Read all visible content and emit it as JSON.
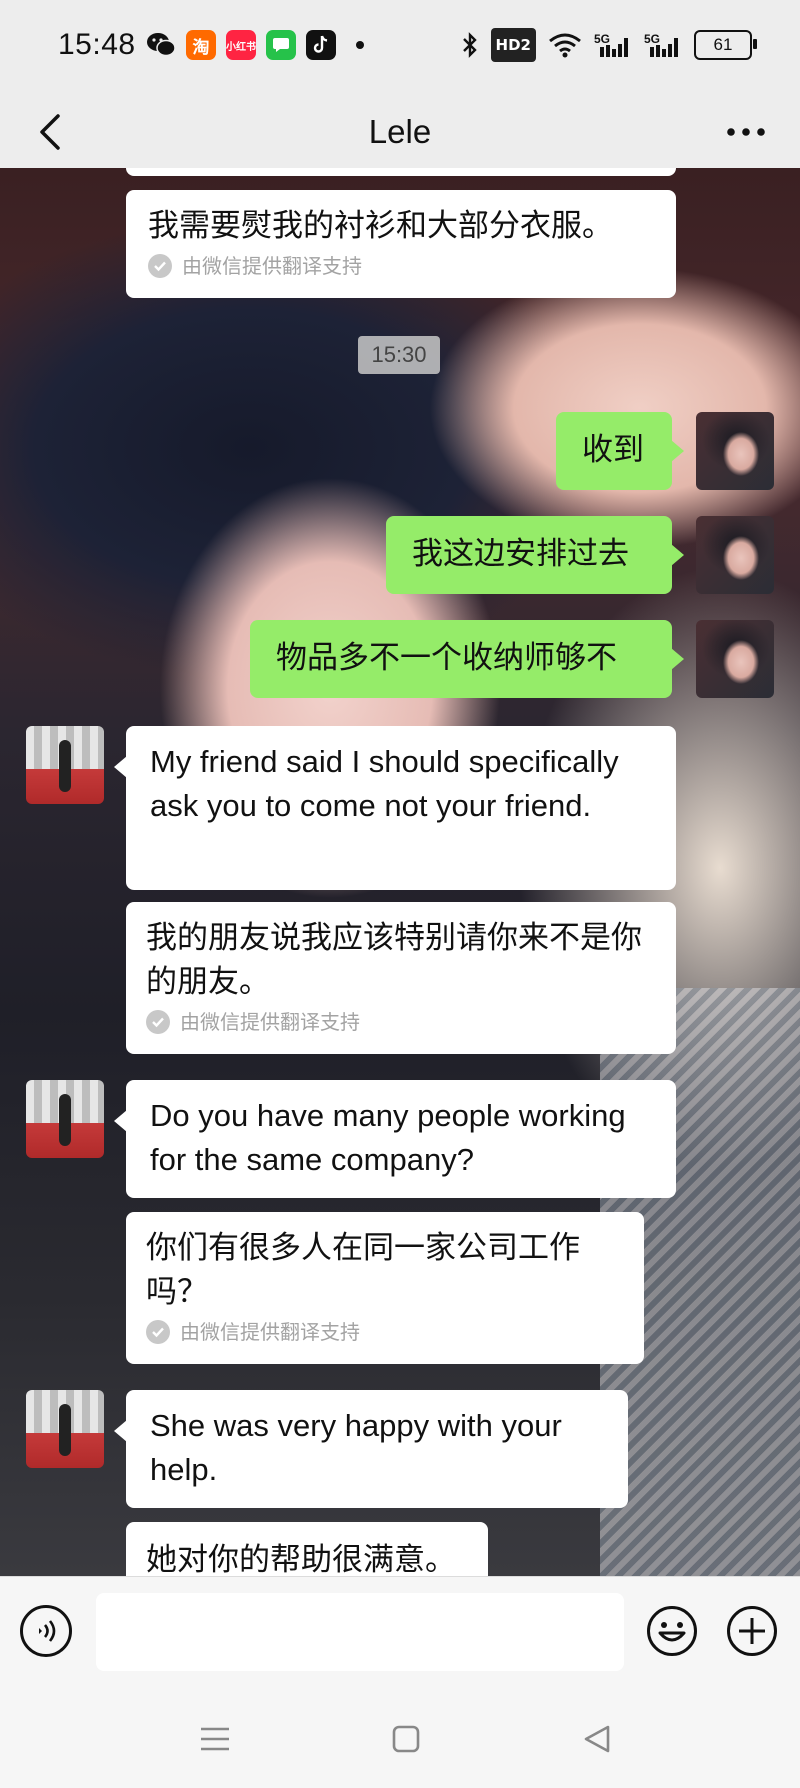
{
  "status_bar": {
    "time": "15:48",
    "app_icons": [
      "wechat-icon",
      "taobao-icon",
      "xiaohongshu-icon",
      "messages-icon",
      "tiktok-icon"
    ],
    "taobao_label": "淘",
    "xhs_label": "小红书",
    "hd_label": "HD2",
    "signal_1": "5G",
    "signal_2": "5G",
    "battery": "61"
  },
  "header": {
    "title": "Lele"
  },
  "chat": {
    "timestamp": "15:30",
    "translation_note": "由微信提供翻译支持",
    "messages": [
      {
        "side": "left",
        "text": "我需要熨我的衬衫和大部分衣服。",
        "translated": true
      },
      {
        "side": "right",
        "text": "收到"
      },
      {
        "side": "right",
        "text": "我这边安排过去"
      },
      {
        "side": "right",
        "text": "物品多不一个收纳师够不"
      },
      {
        "side": "left",
        "text": "My friend said I should specifically ask you to come not your friend."
      },
      {
        "side": "left",
        "text": "我的朋友说我应该特别请你来不是你的朋友。",
        "translated": true
      },
      {
        "side": "left",
        "text": "Do you have many people working for the same company?"
      },
      {
        "side": "left",
        "text": "你们有很多人在同一家公司工作吗？",
        "translated": true
      },
      {
        "side": "left",
        "text": "She was very happy with your help."
      },
      {
        "side": "left",
        "text": "她对你的帮助很满意。"
      }
    ]
  },
  "input_bar": {
    "placeholder": ""
  },
  "colors": {
    "green_bubble": "#95ec69",
    "white_bubble": "#ffffff",
    "bar_bg": "#ededed"
  }
}
